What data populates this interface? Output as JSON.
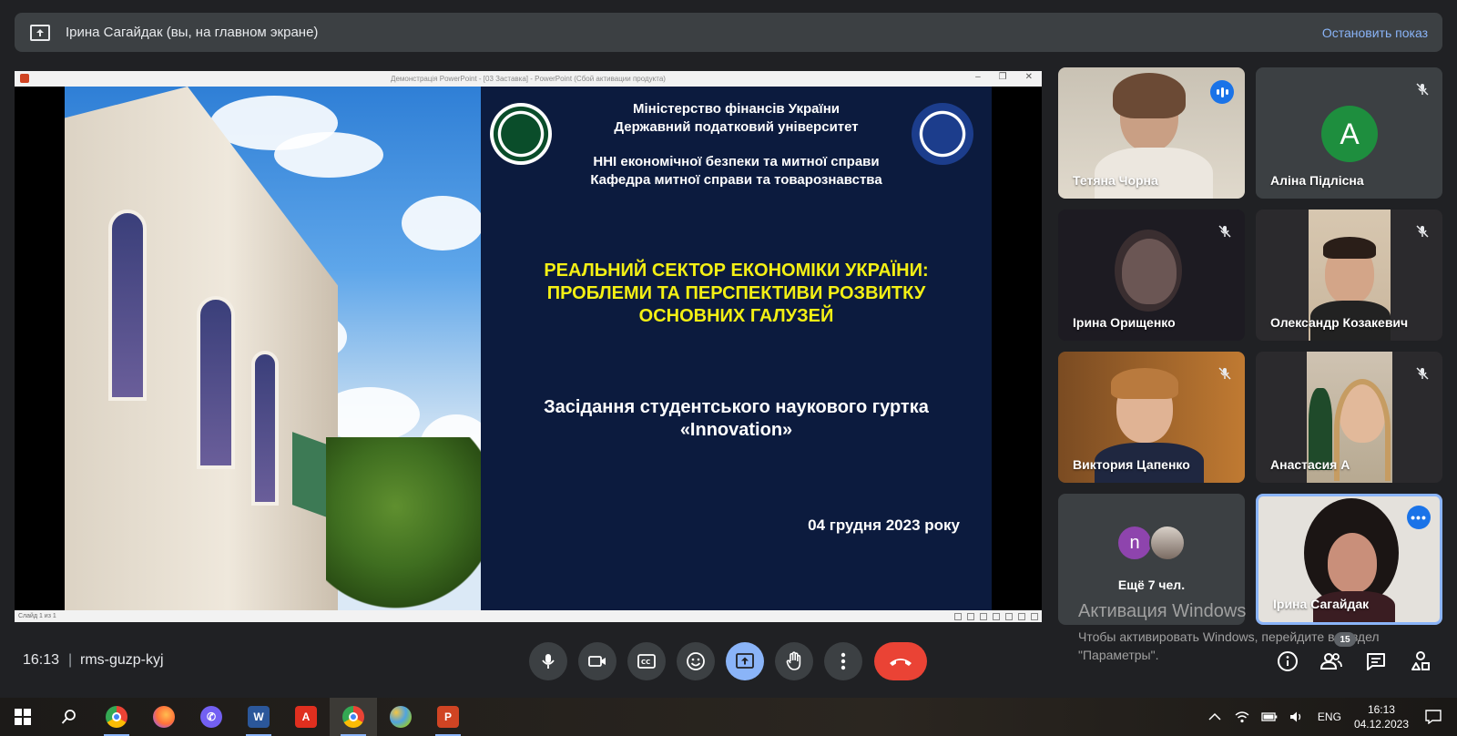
{
  "presenting_bar": {
    "presenter": "Ірина Сагайдак (вы, на главном экране)",
    "stop_label": "Остановить показ"
  },
  "presentation": {
    "window_title": "Демонстрація PowerPoint - [03 Заставка] - PowerPoint (Сбой активации продукта)",
    "status": "Слайд 1 из 1",
    "slide": {
      "ministry": "Міністерство фінансів України",
      "university": "Державний податковий університет",
      "institute": "ННІ економічної безпеки та митної справи",
      "department": "Кафедра митної справи та товарознавства",
      "title_line1": "РЕАЛЬНИЙ СЕКТОР ЕКОНОМІКИ УКРАЇНИ:",
      "title_line2": "ПРОБЛЕМИ ТА ПЕРСПЕКТИВИ РОЗВИТКУ",
      "title_line3": "ОСНОВНИХ ГАЛУЗЕЙ",
      "subtitle_line1": "Засідання студентського наукового гуртка",
      "subtitle_line2": "«Innovation»",
      "date": "04 грудня 2023 року"
    }
  },
  "participants": [
    {
      "name": "Тетяна Чорна",
      "type": "video",
      "speaking": true
    },
    {
      "name": "Аліна Підлісна",
      "type": "avatar",
      "initial": "A",
      "muted": true
    },
    {
      "name": "Ірина Орищенко",
      "type": "video",
      "muted": true
    },
    {
      "name": "Олександр Козакевич",
      "type": "video",
      "muted": true
    },
    {
      "name": "Виктория Цапенко",
      "type": "video",
      "muted": true
    },
    {
      "name": "Анастасия А",
      "type": "video",
      "muted": true
    },
    {
      "name": "Ещё 7 чел.",
      "type": "overflow",
      "initial": "n"
    },
    {
      "name": "Ірина Сагайдак",
      "type": "self"
    }
  ],
  "watermark": {
    "title": "Активация Windows",
    "line1": "Чтобы активировать Windows, перейдите в раздел",
    "line2": "\"Параметры\"."
  },
  "meeting": {
    "time": "16:13",
    "separator": "|",
    "code": "rms-guzp-kyj",
    "participant_count": "15"
  },
  "taskbar": {
    "lang": "ENG",
    "clock_time": "16:13",
    "clock_date": "04.12.2023"
  },
  "colors": {
    "accent": "#8ab4f8",
    "hangup": "#ea4335",
    "slide_bg": "#0c1b3e",
    "slide_title": "#f4f014",
    "avatar_green": "#1e8e3e",
    "avatar_purple": "#8e44ad"
  }
}
